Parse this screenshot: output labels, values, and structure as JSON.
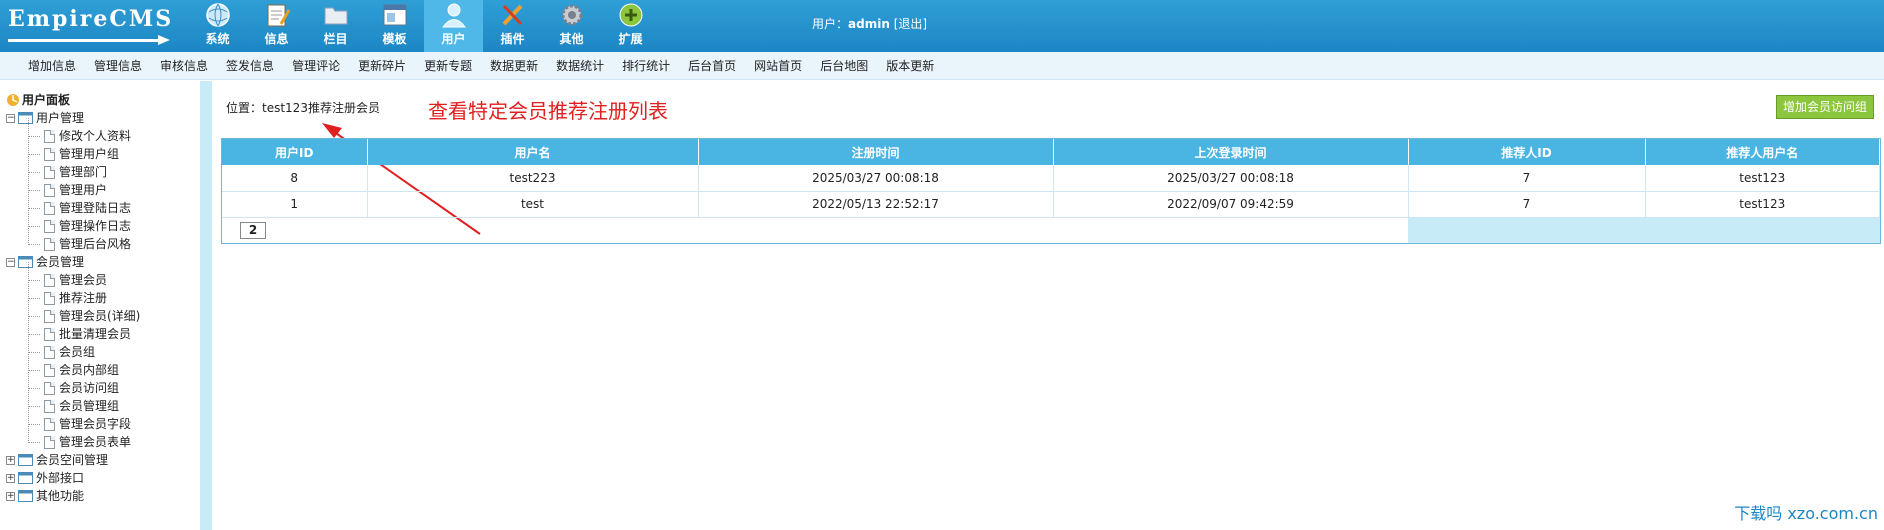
{
  "header": {
    "logo_text": "EmpireCMS",
    "user_label": "用户：",
    "username": "admin",
    "logout": "[退出]",
    "nav": [
      {
        "label": "系统",
        "icon": "globe-icon"
      },
      {
        "label": "信息",
        "icon": "notepad-icon"
      },
      {
        "label": "栏目",
        "icon": "folder-icon"
      },
      {
        "label": "模板",
        "icon": "template-icon"
      },
      {
        "label": "用户",
        "icon": "user-icon"
      },
      {
        "label": "插件",
        "icon": "tools-icon"
      },
      {
        "label": "其他",
        "icon": "gear-icon"
      },
      {
        "label": "扩展",
        "icon": "plus-icon"
      }
    ]
  },
  "subnav": [
    "增加信息",
    "管理信息",
    "审核信息",
    "签发信息",
    "管理评论",
    "更新碎片",
    "更新专题",
    "数据更新",
    "数据统计",
    "排行统计",
    "后台首页",
    "网站首页",
    "后台地图",
    "版本更新"
  ],
  "sidebar": {
    "title": "用户面板",
    "groups": [
      {
        "label": "用户管理",
        "items": [
          "修改个人资料",
          "管理用户组",
          "管理部门",
          "管理用户",
          "管理登陆日志",
          "管理操作日志",
          "管理后台风格"
        ]
      },
      {
        "label": "会员管理",
        "items": [
          "管理会员",
          "推荐注册",
          "管理会员(详细)",
          "批量清理会员",
          "会员组",
          "会员内部组",
          "会员访问组",
          "会员管理组",
          "管理会员字段",
          "管理会员表单"
        ]
      },
      {
        "label": "会员空间管理"
      },
      {
        "label": "外部接口"
      },
      {
        "label": "其他功能"
      }
    ]
  },
  "main": {
    "location": "位置：test123推荐注册会员",
    "annotation": "查看特定会员推荐注册列表",
    "add_button": "增加会员访问组",
    "columns": [
      "用户ID",
      "用户名",
      "注册时间",
      "上次登录时间",
      "推荐人ID",
      "推荐人用户名"
    ],
    "rows": [
      [
        "8",
        "test223",
        "2025/03/27 00:08:18",
        "2025/03/27 00:08:18",
        "7",
        "test123"
      ],
      [
        "1",
        "test",
        "2022/05/13 22:52:17",
        "2022/09/07 09:42:59",
        "7",
        "test123"
      ]
    ],
    "pager": "2"
  },
  "watermark": "下载吗 xzo.com.cn",
  "colors": {
    "accent": "#1c86c4",
    "header_active": "#4fb8e8",
    "table_header": "#4ab5e2",
    "annotation": "#e02020",
    "button": "#8cc63f"
  }
}
